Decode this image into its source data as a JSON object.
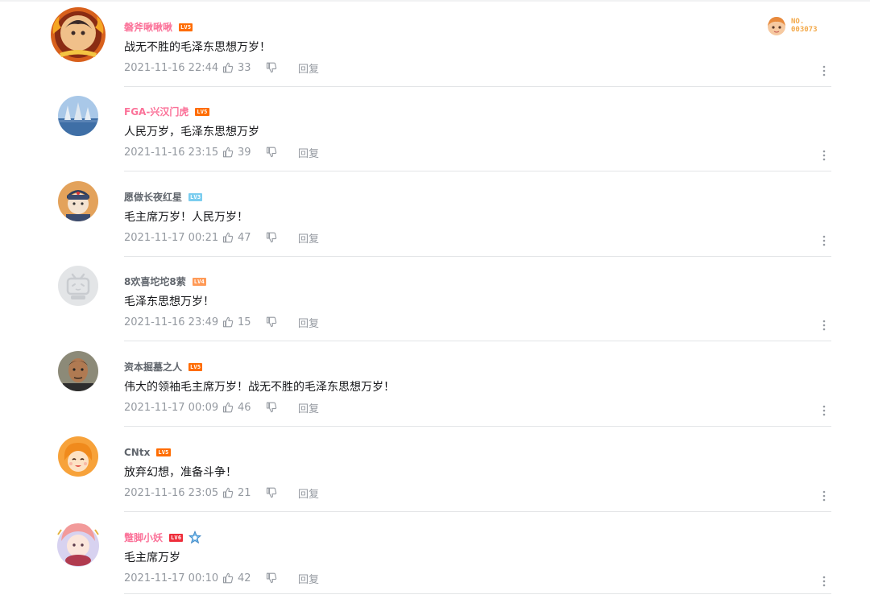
{
  "colors": {
    "vip_name": "#fb7299",
    "normal_name": "#61666d",
    "meta": "#9499a0",
    "divider": "#e3e5e7",
    "lv6": "#ee2d3a",
    "lv5": "#ff6c00",
    "lv4": "#ff9a57",
    "lv3": "#7bcdef"
  },
  "fan_badge": {
    "line1": "NO.",
    "line2": "003073"
  },
  "comments": [
    {
      "username": "磐斧啾啾啾",
      "level": "LV5",
      "text": "战无不胜的毛泽东思想万岁！",
      "time": "2021-11-16 22:44",
      "likes": "33",
      "reply": "回复"
    },
    {
      "username": "FGA-兴汉门虎",
      "level": "LV5",
      "text": "人民万岁，毛泽东思想万岁",
      "time": "2021-11-16 23:15",
      "likes": "39",
      "reply": "回复"
    },
    {
      "username": "愿做长夜红星",
      "level": "LV3",
      "text": "毛主席万岁！人民万岁！",
      "time": "2021-11-17 00:21",
      "likes": "47",
      "reply": "回复"
    },
    {
      "username": "8欢喜坨坨8萦",
      "level": "LV4",
      "text": "毛泽东思想万岁！",
      "time": "2021-11-16 23:49",
      "likes": "15",
      "reply": "回复"
    },
    {
      "username": "资本掘墓之人",
      "level": "LV5",
      "text": "伟大的领袖毛主席万岁！战无不胜的毛泽东思想万岁！",
      "time": "2021-11-17 00:09",
      "likes": "46",
      "reply": "回复"
    },
    {
      "username": "CNtx",
      "level": "LV5",
      "text": "放弃幻想，准备斗争！",
      "time": "2021-11-16 23:05",
      "likes": "21",
      "reply": "回复"
    },
    {
      "username": "蹩脚小妖",
      "level": "LV6",
      "text": "毛主席万岁",
      "time": "2021-11-17 00:10",
      "likes": "42",
      "reply": "回复"
    }
  ]
}
